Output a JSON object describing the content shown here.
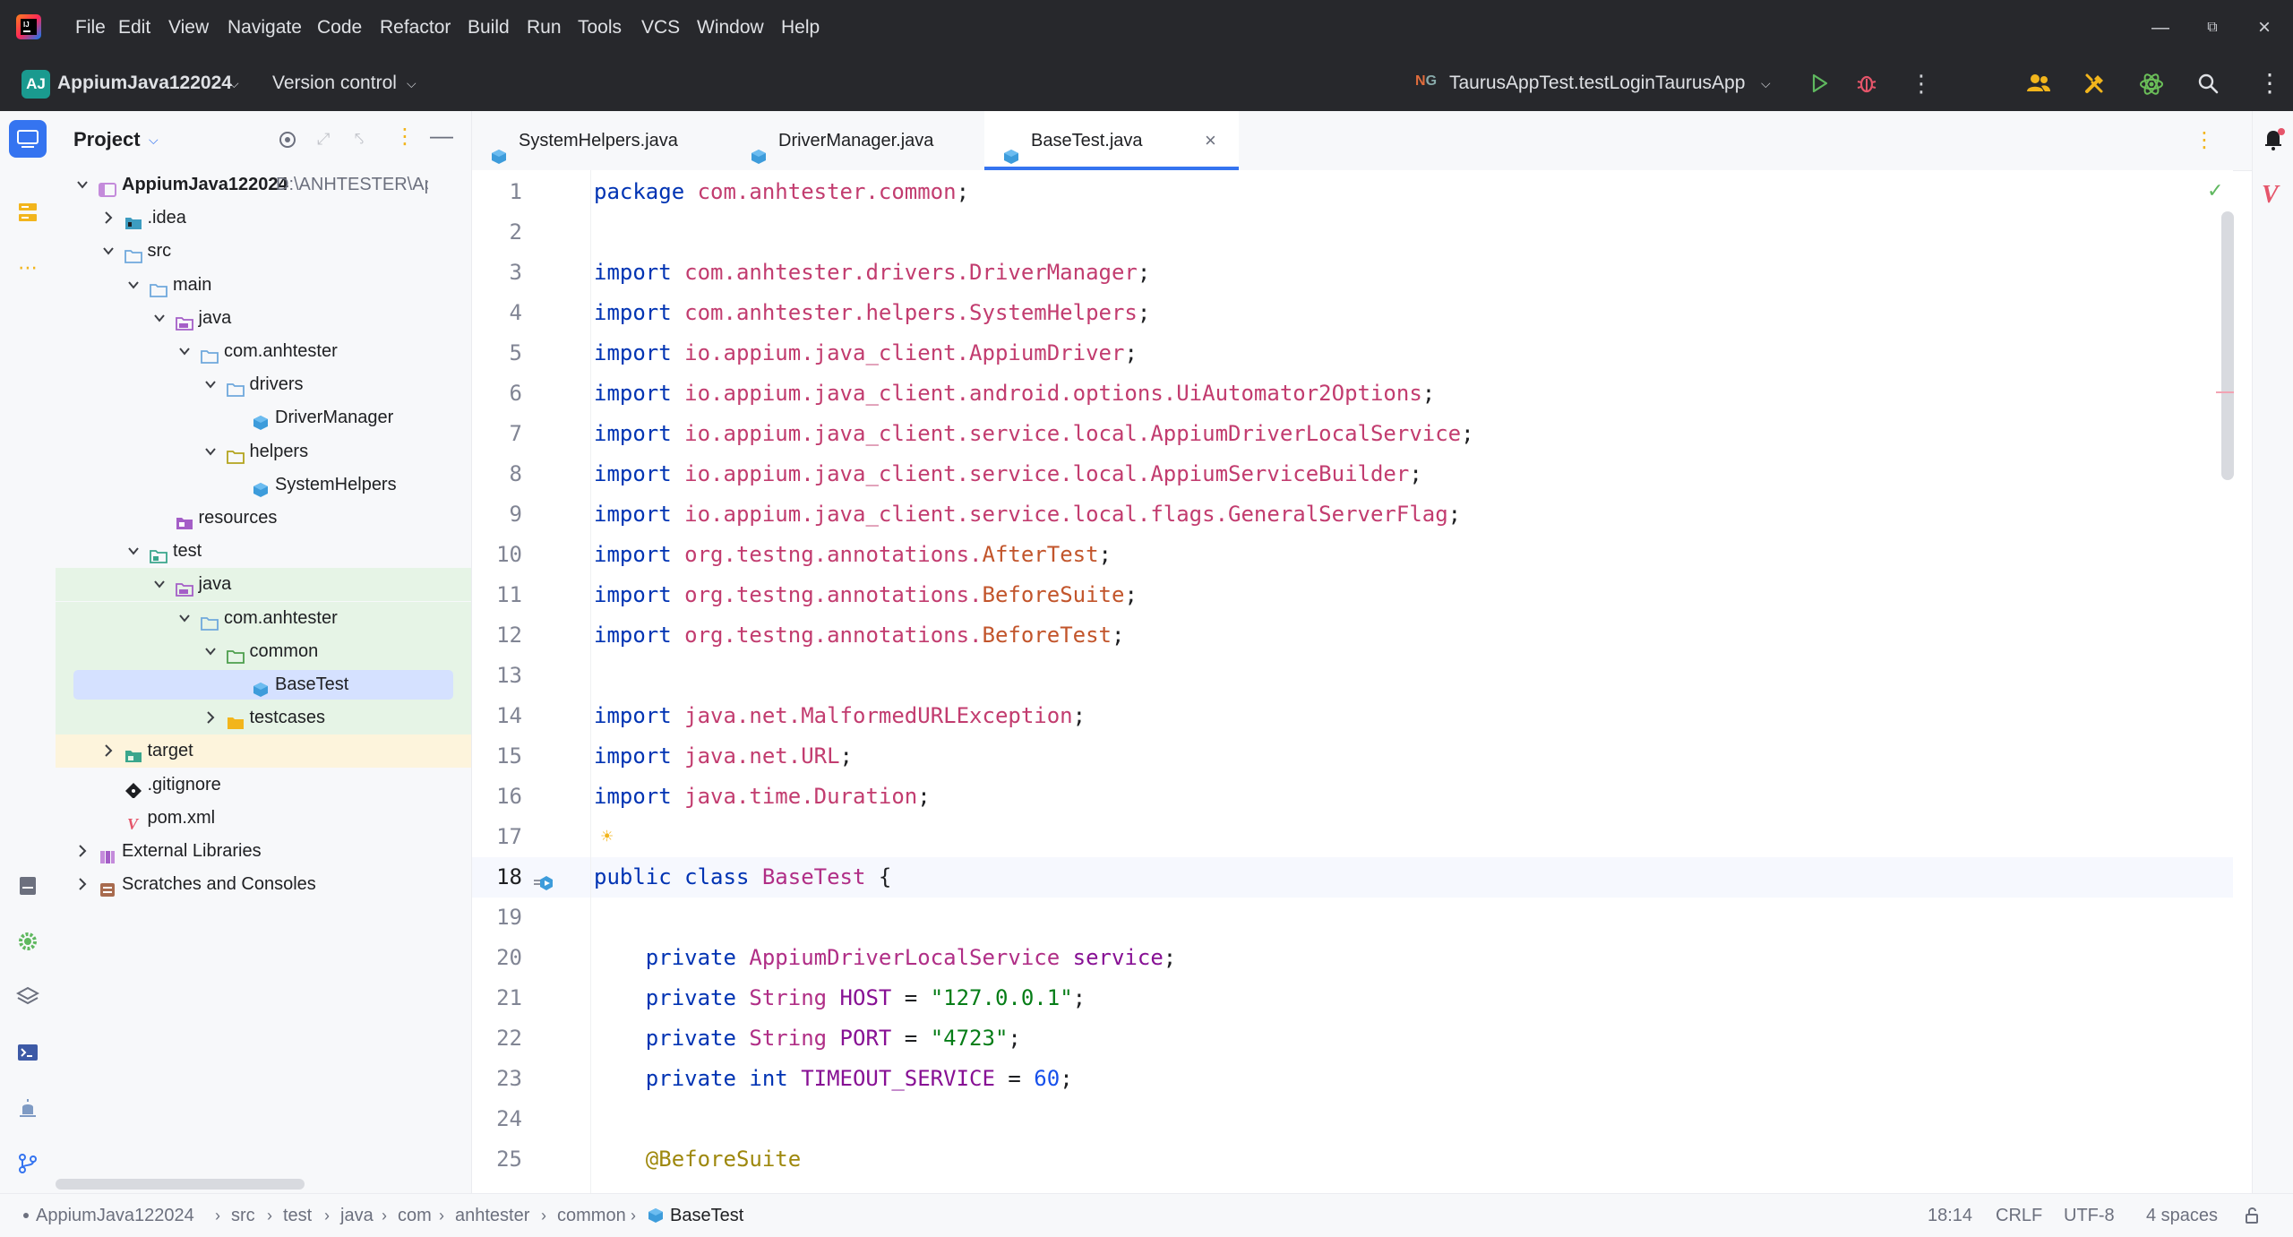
{
  "menu": [
    "File",
    "Edit",
    "View",
    "Navigate",
    "Code",
    "Refactor",
    "Build",
    "Run",
    "Tools",
    "VCS",
    "Window",
    "Help"
  ],
  "project": {
    "badge": "AJ",
    "name": "AppiumJava122024"
  },
  "vcs_label": "Version control",
  "run_config": "TaurusAppTest.testLoginTaurusApp",
  "panel_title": "Project",
  "tree": [
    {
      "label": "AppiumJava122024",
      "extra": "D:\\ANHTESTER\\Ap",
      "depth": 0,
      "chev": "down",
      "icon": "module",
      "bold": true
    },
    {
      "label": ".idea",
      "depth": 1,
      "chev": "right",
      "icon": "folder-idea"
    },
    {
      "label": "src",
      "depth": 1,
      "chev": "down",
      "icon": "folder-src"
    },
    {
      "label": "main",
      "depth": 2,
      "chev": "down",
      "icon": "folder-src"
    },
    {
      "label": "java",
      "depth": 3,
      "chev": "down",
      "icon": "folder-java"
    },
    {
      "label": "com.anhtester",
      "depth": 4,
      "chev": "down",
      "icon": "folder-pkg"
    },
    {
      "label": "drivers",
      "depth": 5,
      "chev": "down",
      "icon": "folder-pkg"
    },
    {
      "label": "DriverManager",
      "depth": 6,
      "chev": "",
      "icon": "class"
    },
    {
      "label": "helpers",
      "depth": 5,
      "chev": "down",
      "icon": "folder-pkg-y"
    },
    {
      "label": "SystemHelpers",
      "depth": 6,
      "chev": "",
      "icon": "class"
    },
    {
      "label": "resources",
      "depth": 3,
      "chev": "",
      "icon": "folder-res"
    },
    {
      "label": "test",
      "depth": 2,
      "chev": "down",
      "icon": "folder-test"
    },
    {
      "label": "java",
      "depth": 3,
      "chev": "down",
      "icon": "folder-java",
      "hl": "green"
    },
    {
      "label": "com.anhtester",
      "depth": 4,
      "chev": "down",
      "icon": "folder-pkg",
      "hl": "green"
    },
    {
      "label": "common",
      "depth": 5,
      "chev": "down",
      "icon": "folder-pkg-g",
      "hl": "green"
    },
    {
      "label": "BaseTest",
      "depth": 6,
      "chev": "",
      "icon": "class",
      "hl": "selected"
    },
    {
      "label": "testcases",
      "depth": 5,
      "chev": "right",
      "icon": "folder-yellow",
      "hl": "green"
    },
    {
      "label": "target",
      "depth": 1,
      "chev": "right",
      "icon": "folder-target",
      "hl": "yellow"
    },
    {
      "label": ".gitignore",
      "depth": 1,
      "chev": "",
      "icon": "git"
    },
    {
      "label": "pom.xml",
      "depth": 1,
      "chev": "",
      "icon": "maven"
    },
    {
      "label": "External Libraries",
      "depth": 0,
      "chev": "right",
      "icon": "libs"
    },
    {
      "label": "Scratches and Consoles",
      "depth": 0,
      "chev": "right",
      "icon": "scratch"
    }
  ],
  "tabs": [
    {
      "label": "SystemHelpers.java",
      "active": false
    },
    {
      "label": "DriverManager.java",
      "active": false
    },
    {
      "label": "BaseTest.java",
      "active": true
    }
  ],
  "code": [
    {
      "n": "1",
      "t": [
        [
          "kw",
          "package "
        ],
        [
          "pk",
          "com.anhtester.common"
        ],
        [
          "",
          "; "
        ]
      ]
    },
    {
      "n": "2",
      "t": []
    },
    {
      "n": "3",
      "t": [
        [
          "kw",
          "import "
        ],
        [
          "pk",
          "com.anhtester.drivers.DriverManager"
        ],
        [
          "",
          ";"
        ]
      ]
    },
    {
      "n": "4",
      "t": [
        [
          "kw",
          "import "
        ],
        [
          "pk",
          "com.anhtester.helpers.SystemHelpers"
        ],
        [
          "",
          ";"
        ]
      ]
    },
    {
      "n": "5",
      "t": [
        [
          "kw",
          "import "
        ],
        [
          "pk",
          "io.appium.java_client.AppiumDriver"
        ],
        [
          "",
          ";"
        ]
      ]
    },
    {
      "n": "6",
      "t": [
        [
          "kw",
          "import "
        ],
        [
          "pk",
          "io.appium.java_client.android.options.UiAutomator2Options"
        ],
        [
          "",
          ";"
        ]
      ]
    },
    {
      "n": "7",
      "t": [
        [
          "kw",
          "import "
        ],
        [
          "pk",
          "io.appium.java_client.service.local.AppiumDriverLocalService"
        ],
        [
          "",
          ";"
        ]
      ]
    },
    {
      "n": "8",
      "t": [
        [
          "kw",
          "import "
        ],
        [
          "pk",
          "io.appium.java_client.service.local.AppiumServiceBuilder"
        ],
        [
          "",
          ";"
        ]
      ]
    },
    {
      "n": "9",
      "t": [
        [
          "kw",
          "import "
        ],
        [
          "pk",
          "io.appium.java_client.service.local.flags.GeneralServerFlag"
        ],
        [
          "",
          ";"
        ]
      ]
    },
    {
      "n": "10",
      "t": [
        [
          "kw",
          "import "
        ],
        [
          "pk",
          "org.testng.annotations."
        ],
        [
          "imp",
          "AfterTest"
        ],
        [
          "",
          ";"
        ]
      ]
    },
    {
      "n": "11",
      "t": [
        [
          "kw",
          "import "
        ],
        [
          "pk",
          "org.testng.annotations."
        ],
        [
          "imp",
          "BeforeSuite"
        ],
        [
          "",
          ";"
        ]
      ]
    },
    {
      "n": "12",
      "t": [
        [
          "kw",
          "import "
        ],
        [
          "pk",
          "org.testng.annotations."
        ],
        [
          "imp",
          "BeforeTest"
        ],
        [
          "",
          ";"
        ]
      ]
    },
    {
      "n": "13",
      "t": []
    },
    {
      "n": "14",
      "t": [
        [
          "kw",
          "import "
        ],
        [
          "pk",
          "java.net.MalformedURLException"
        ],
        [
          "",
          ";"
        ]
      ]
    },
    {
      "n": "15",
      "t": [
        [
          "kw",
          "import "
        ],
        [
          "pk",
          "java.net.URL"
        ],
        [
          "",
          ";"
        ]
      ]
    },
    {
      "n": "16",
      "t": [
        [
          "kw",
          "import "
        ],
        [
          "pk",
          "java.time.Duration"
        ],
        [
          "",
          ";"
        ]
      ]
    },
    {
      "n": "17",
      "t": []
    },
    {
      "n": "18",
      "t": [
        [
          "kw",
          "public class "
        ],
        [
          "cls",
          "BaseTest"
        ],
        [
          "",
          " {"
        ]
      ],
      "current": true
    },
    {
      "n": "19",
      "t": []
    },
    {
      "n": "20",
      "t": [
        [
          "",
          "    "
        ],
        [
          "kw",
          "private "
        ],
        [
          "cls",
          "AppiumDriverLocalService "
        ],
        [
          "fld",
          "service"
        ],
        [
          "",
          ";"
        ]
      ]
    },
    {
      "n": "21",
      "t": [
        [
          "",
          "    "
        ],
        [
          "kw",
          "private "
        ],
        [
          "cls",
          "String "
        ],
        [
          "fld",
          "HOST"
        ],
        [
          "",
          " = "
        ],
        [
          "str",
          "\"127.0.0.1\""
        ],
        [
          "",
          ";"
        ]
      ]
    },
    {
      "n": "22",
      "t": [
        [
          "",
          "    "
        ],
        [
          "kw",
          "private "
        ],
        [
          "cls",
          "String "
        ],
        [
          "fld",
          "PORT"
        ],
        [
          "",
          " = "
        ],
        [
          "str",
          "\"4723\""
        ],
        [
          "",
          ";"
        ]
      ]
    },
    {
      "n": "23",
      "t": [
        [
          "",
          "    "
        ],
        [
          "kw",
          "private int "
        ],
        [
          "fld",
          "TIMEOUT_SERVICE"
        ],
        [
          "",
          " = "
        ],
        [
          "num",
          "60"
        ],
        [
          "",
          ";"
        ]
      ]
    },
    {
      "n": "24",
      "t": []
    },
    {
      "n": "25",
      "t": [
        [
          "",
          "    "
        ],
        [
          "ann",
          "@BeforeSuite"
        ]
      ]
    }
  ],
  "breadcrumbs": [
    "AppiumJava122024",
    "src",
    "test",
    "java",
    "com",
    "anhtester",
    "common",
    "BaseTest"
  ],
  "status": {
    "position": "18:14",
    "line_sep": "CRLF",
    "encoding": "UTF-8",
    "indent": "4 spaces"
  },
  "colors": {
    "accent": "#3574f0",
    "title_bg": "#27282c",
    "selected_row": "#d5e1ff",
    "green_row": "#e6f4e6",
    "yellow_row": "#fdf4dc"
  }
}
